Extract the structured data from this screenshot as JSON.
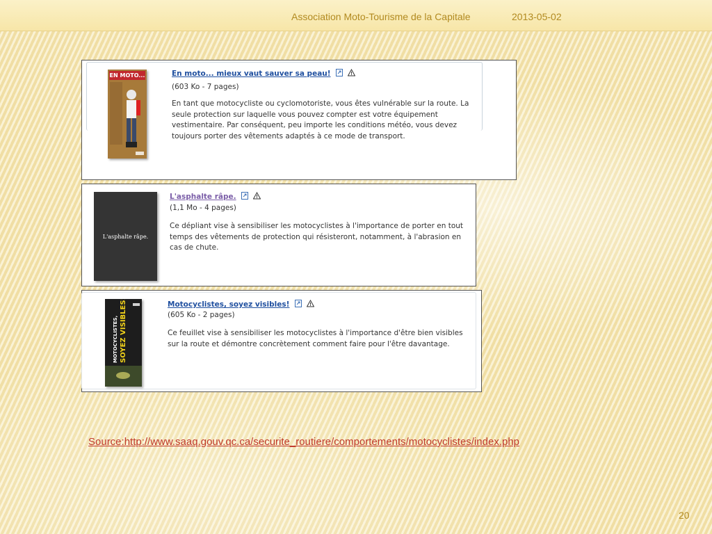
{
  "header": {
    "organization": "Association Moto-Tourisme de la Capitale",
    "date": "2013-05-02"
  },
  "documents": [
    {
      "title": "En moto... mieux vaut sauver sa peau!",
      "size": "(603 Ko - 7 pages)",
      "description": "En tant que motocycliste ou cyclomotoriste, vous êtes vulnérable sur la route. La seule protection sur laquelle vous pouvez compter est votre équipement vestimentaire. Par conséquent, peu importe les conditions météo, vous devez toujours porter des vêtements adaptés à ce mode de transport.",
      "cover_text": "EN MOTO..."
    },
    {
      "title": "L'asphalte râpe.",
      "size": "(1,1 Mo - 4 pages)",
      "description": "Ce dépliant vise à sensibiliser les motocyclistes à l'importance de porter en tout temps des vêtements de protection qui résisteront, notamment, à l'abrasion en cas de chute.",
      "cover_text": "L'asphalte râpe."
    },
    {
      "title": "Motocyclistes, soyez visibles!",
      "size": "(605 Ko - 2 pages)",
      "description": "Ce feuillet vise à sensibiliser les motocyclistes à l'importance d'être bien visibles sur la route et démontre concrètement comment faire pour l'être davantage.",
      "cover_text_1": "MOTOCYCLISTES,",
      "cover_text_2": "SOYEZ VISIBLES!"
    }
  ],
  "footer": {
    "source": "Source:http://www.saaq.gouv.qc.ca/securite_routiere/comportements/motocyclistes/index.php"
  },
  "page_number": "20",
  "colors": {
    "link": "#1f4f9f",
    "visited_link": "#7b5ea8",
    "header_text": "#b28a20",
    "source_link": "#c0392b"
  },
  "icons": [
    "external-link-icon",
    "warning-icon"
  ]
}
